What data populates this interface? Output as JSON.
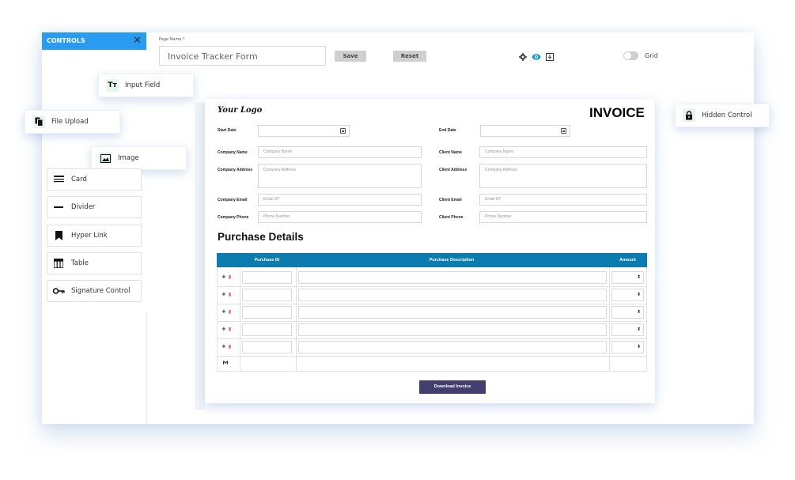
{
  "controls": {
    "title": "CONTROLS",
    "close_icon": "close-icon",
    "floating": [
      {
        "label": "Input Field",
        "icon": "text-type-icon",
        "glyph": "Tт"
      },
      {
        "label": "File Upload",
        "icon": "file-copy-icon"
      },
      {
        "label": "Image",
        "icon": "image-icon"
      },
      {
        "label": "Hidden Control",
        "icon": "lock-icon"
      }
    ],
    "items": [
      {
        "label": "Card",
        "icon": "card-icon"
      },
      {
        "label": "Divider",
        "icon": "divider-icon"
      },
      {
        "label": "Hyper Link",
        "icon": "bookmark-icon"
      },
      {
        "label": "Table",
        "icon": "table-icon"
      },
      {
        "label": "Signature Control",
        "icon": "key-icon"
      }
    ]
  },
  "toolbar": {
    "page_name_label": "Page Name *",
    "page_name_value": "Invoice Tracker Form",
    "save_label": "Save",
    "reset_label": "Reset",
    "grid_label": "Grid",
    "grid_enabled": false,
    "icons": [
      "gear-icon",
      "eye-icon",
      "download-icon"
    ],
    "accent": "#2a9cf0"
  },
  "form": {
    "logo_text": "Your Logo",
    "title": "INVOICE",
    "start_date_label": "Start Date",
    "end_date_label": "End Date",
    "company_name_label": "Company Name",
    "company_name_placeholder": "Company Name",
    "client_name_label": "Client Name",
    "client_name_placeholder": "Company Name",
    "company_address_label": "Company Address",
    "company_address_placeholder": "Company Address",
    "client_address_label": "Client Address",
    "client_address_placeholder": "Company Address",
    "company_email_label": "Company Email",
    "company_email_placeholder": "Email ID*",
    "client_email_label": "Client Email",
    "client_email_placeholder": "Email ID*",
    "company_phone_label": "Company Phone",
    "company_phone_placeholder": "Phone Number",
    "client_phone_label": "Client Phone",
    "client_phone_placeholder": "Phone Number",
    "section_title": "Purchase Details",
    "table": {
      "headers": [
        "Purchase ID",
        "Purchase Description",
        "Amount"
      ],
      "row_count": 5,
      "add_glyph": "+",
      "delete_icon": "trash-icon",
      "sum_glyph": "Σ",
      "header_color": "#0b7cad"
    },
    "download_label": "Download Invoice",
    "download_color": "#413f6e"
  }
}
